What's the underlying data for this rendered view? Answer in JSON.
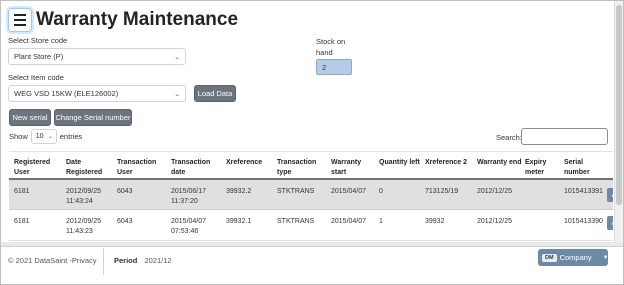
{
  "header": {
    "title": "Warranty Maintenance"
  },
  "store": {
    "label": "Select Store code",
    "value": "Plant Store (P)"
  },
  "item": {
    "label": "Select Item code",
    "value": "WEG VSD 15KW (ELE126002)"
  },
  "stock": {
    "label": "Stock on hand",
    "value": "2"
  },
  "buttons": {
    "load": "Load Data",
    "new_serial": "New serial",
    "change_serial": "Change Serial number"
  },
  "table_controls": {
    "show": "Show",
    "entries_value": "10",
    "entries": "entries",
    "search_label": "Search:"
  },
  "table": {
    "columns": [
      "Registered User",
      "Date Registered",
      "Transaction User",
      "Transaction date",
      "Xreference",
      "Transaction type",
      "Warranty start",
      "Quantity left",
      "Xreference 2",
      "Warranty end",
      "Expiry meter",
      "Serial number"
    ],
    "rows": [
      [
        "6181",
        "2012/09/25 11:43:24",
        "6043",
        "2015/06/17 11:37:20",
        "39932.2",
        "STKTRANS",
        "2015/04/07",
        "0",
        "713125/19",
        "2012/12/25",
        "",
        "1015413391"
      ],
      [
        "6181",
        "2012/09/25 11:43:23",
        "6043",
        "2015/04/07 07:53:46",
        "39932.1",
        "STKTRANS",
        "2015/04/07",
        "1",
        "39932",
        "2012/12/25",
        "",
        "1015413390"
      ]
    ],
    "row_button": "A"
  },
  "footer": {
    "copyright": "© 2021 DataSaint - ",
    "privacy": "Privacy",
    "period_label": "Period",
    "period_value": "2021/12",
    "company_badge": "DM",
    "company_label": "Company"
  }
}
